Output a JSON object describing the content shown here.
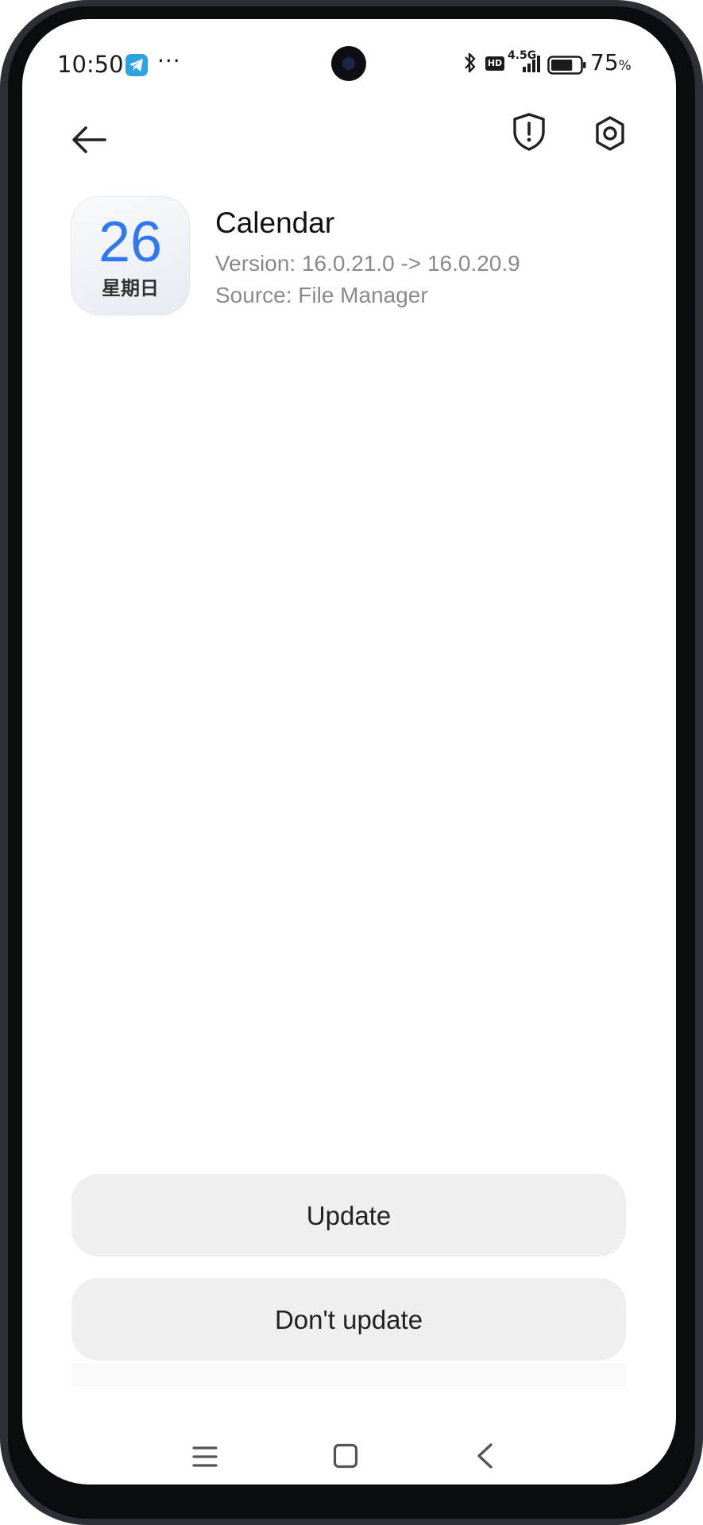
{
  "status_bar": {
    "time": "10:50",
    "network_label": "4.5G",
    "hd_label": "HD",
    "battery_percent": "75",
    "battery_unit": "%",
    "battery_level": 0.75,
    "icons": [
      "telegram-icon",
      "more-dots-icon",
      "bluetooth-icon",
      "hd-icon",
      "signal-icon",
      "battery-icon"
    ]
  },
  "header": {
    "back_icon": "arrow-left-icon",
    "shield_icon": "shield-alert-icon",
    "settings_icon": "settings-gear-icon"
  },
  "app": {
    "icon_day": "26",
    "icon_weekday": "星期日",
    "name": "Calendar",
    "version": "Version: 16.0.21.0 -> 16.0.20.9",
    "source": "Source: File Manager"
  },
  "actions": {
    "update_label": "Update",
    "dont_update_label": "Don't update"
  },
  "nav_bar": {
    "icons": [
      "menu-icon",
      "home-icon",
      "back-chevron-icon"
    ]
  },
  "colors": {
    "accent_blue": "#2f78f0",
    "button_bg": "#efefef",
    "secondary_text": "#8a8a8a",
    "frame": "#2c2f35"
  }
}
